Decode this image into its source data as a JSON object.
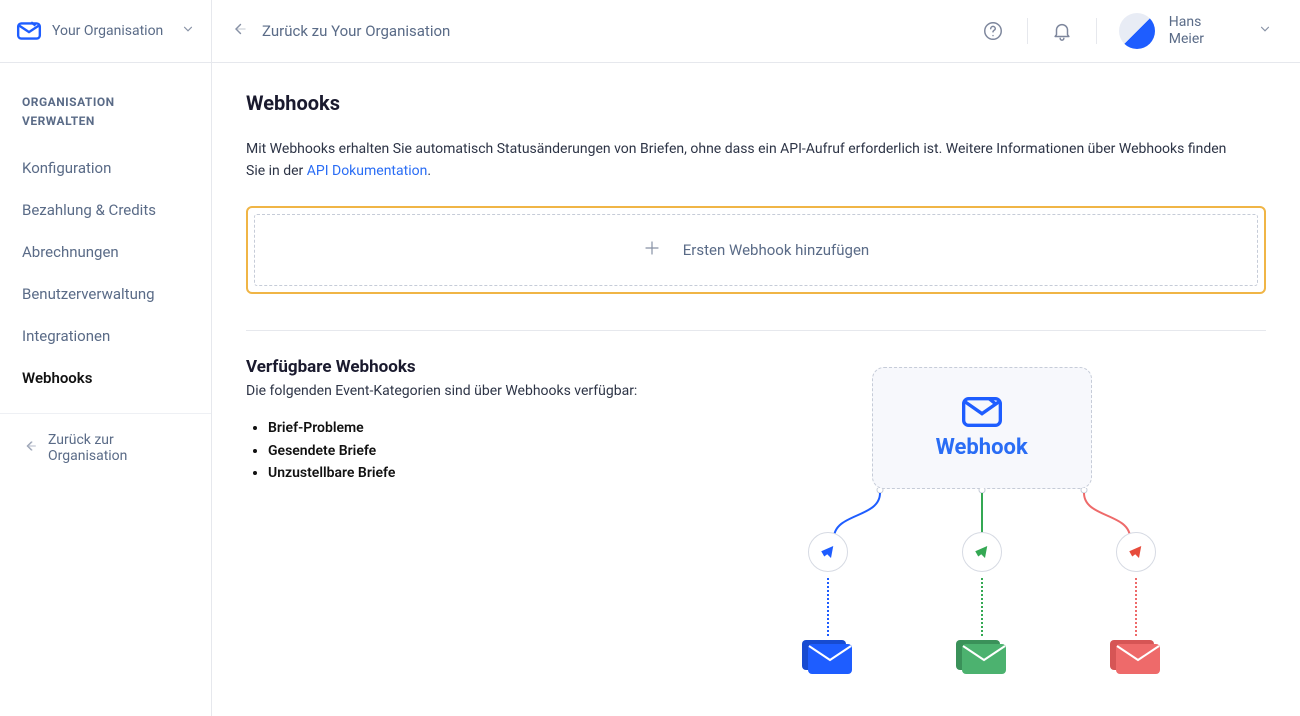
{
  "org": {
    "name": "Your Organisation"
  },
  "sidebar": {
    "section_title": "ORGANISATION VERWALTEN",
    "items": [
      {
        "label": "Konfiguration"
      },
      {
        "label": "Bezahlung & Credits"
      },
      {
        "label": "Abrechnungen"
      },
      {
        "label": "Benutzerverwaltung"
      },
      {
        "label": "Integrationen"
      },
      {
        "label": "Webhooks"
      }
    ],
    "back_label": "Zurück zur Organisation"
  },
  "header": {
    "back_label": "Zurück zu Your Organisation",
    "user_first": "Hans",
    "user_last": "Meier"
  },
  "page": {
    "title": "Webhooks",
    "intro_pre": "Mit Webhooks erhalten Sie automatisch Statusänderungen von Briefen, ohne dass ein API-Aufruf erforderlich ist. Weitere Informationen über Webhooks finden Sie in der ",
    "intro_link": "API Dokumentation",
    "intro_post": ".",
    "add_label": "Ersten Webhook hinzufügen"
  },
  "available": {
    "title": "Verfügbare Webhooks",
    "subtitle": "Die folgenden Event-Kategorien sind über Webhooks verfügbar:",
    "events": [
      "Brief-Probleme",
      "Gesendete Briefe",
      "Unzustellbare Briefe"
    ]
  },
  "diagram": {
    "box_label": "Webhook"
  }
}
